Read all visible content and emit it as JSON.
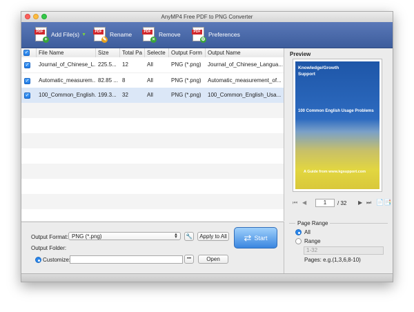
{
  "window": {
    "title": "AnyMP4 Free PDF to PNG Converter"
  },
  "toolbar": {
    "add": "Add File(s)",
    "rename": "Rename",
    "remove": "Remove",
    "preferences": "Preferences",
    "icon_tag": "PDF"
  },
  "table": {
    "headers": [
      "File Name",
      "Size",
      "Total Pa",
      "Selecte",
      "Output Form",
      "Output Name"
    ],
    "rows": [
      {
        "file": "Journal_of_Chinese_L...",
        "size": "225.5...",
        "total": "12",
        "selected": "All",
        "format": "PNG (*.png)",
        "name": "Journal_of_Chinese_Langua..."
      },
      {
        "file": "Automatic_measurem...",
        "size": "82.85 ...",
        "total": "8",
        "selected": "All",
        "format": "PNG (*.png)",
        "name": "Automatic_measurement_of..."
      },
      {
        "file": "100_Common_English...",
        "size": "199.3...",
        "total": "32",
        "selected": "All",
        "format": "PNG (*.png)",
        "name": "100_Common_English_Usa..."
      }
    ]
  },
  "output": {
    "format_label": "Output Format:",
    "format_value": "PNG (*.png)",
    "apply_all": "Apply to All",
    "folder_label": "Output Folder:",
    "customize_label": "Customize:",
    "browse": "•••",
    "open": "Open",
    "start": "Start"
  },
  "preview": {
    "label": "Preview",
    "cover_title": "Knowledge/Growth Support",
    "cover_subtitle": "100 Common English Usage Problems",
    "cover_footer": "A Guide from www.kgsupport.com",
    "page_value": "1",
    "page_total": "/ 32"
  },
  "range": {
    "title": "Page Range",
    "all": "All",
    "range": "Range",
    "placeholder": "1-32",
    "hint": "Pages: e.g.(1,3,6,8-10)"
  },
  "colors": {
    "accent": "#1f7ce8",
    "toolbar": "#4a6aab",
    "pdf_red": "#d2272d"
  }
}
